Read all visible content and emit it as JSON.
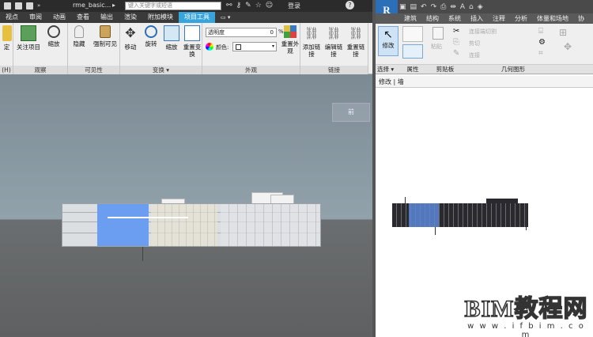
{
  "left_app": {
    "doc_title": "rme_basic...",
    "search_placeholder": "键入关键字或短语",
    "login": "登录",
    "tabs": [
      "视点",
      "审阅",
      "动画",
      "查看",
      "输出",
      "渲染",
      "附加模块",
      "项目工具"
    ],
    "ribbon": {
      "groups": [
        {
          "label": "(H)",
          "buttons": [
            "定"
          ]
        },
        {
          "label": "观察",
          "buttons": [
            "关注项目",
            "缩放"
          ]
        },
        {
          "label": "可见性",
          "buttons": [
            "隐藏",
            "强制可见"
          ]
        },
        {
          "label": "变换 ▾",
          "buttons": [
            "移动",
            "旋转",
            "缩放",
            "重置变换"
          ]
        },
        {
          "label": "外观",
          "transparency_label": "透明度",
          "transparency_value": "0",
          "transparency_unit": "%",
          "color_label": "颜色:",
          "buttons": [
            "重置外观"
          ]
        },
        {
          "label": "链接",
          "buttons": [
            "添加链接",
            "编辑链接",
            "重置链接"
          ]
        }
      ]
    },
    "viewcube_ghost": "前"
  },
  "right_app": {
    "logo": "R",
    "tabs": [
      "建筑",
      "结构",
      "系统",
      "插入",
      "注释",
      "分析",
      "体量和场地",
      "协"
    ],
    "ribbon": {
      "modify_label": "修改",
      "select_label": "选择 ▾",
      "properties_label": "属性",
      "clipboard_label": "剪贴板",
      "paste_label": "粘贴",
      "geometry_label": "几何图形",
      "geometry_items": [
        "连接端切割",
        "剪切",
        "连接"
      ]
    },
    "breadcrumb": "修改 | 墙"
  },
  "watermark": {
    "main": "BIM教程网",
    "url": "w w w . i f b i m . c o m"
  },
  "colors": {
    "project_tools_tab": "#37a5dc",
    "revit_blue": "#2a6fb8",
    "selection_blue": "#6b9ef0"
  }
}
